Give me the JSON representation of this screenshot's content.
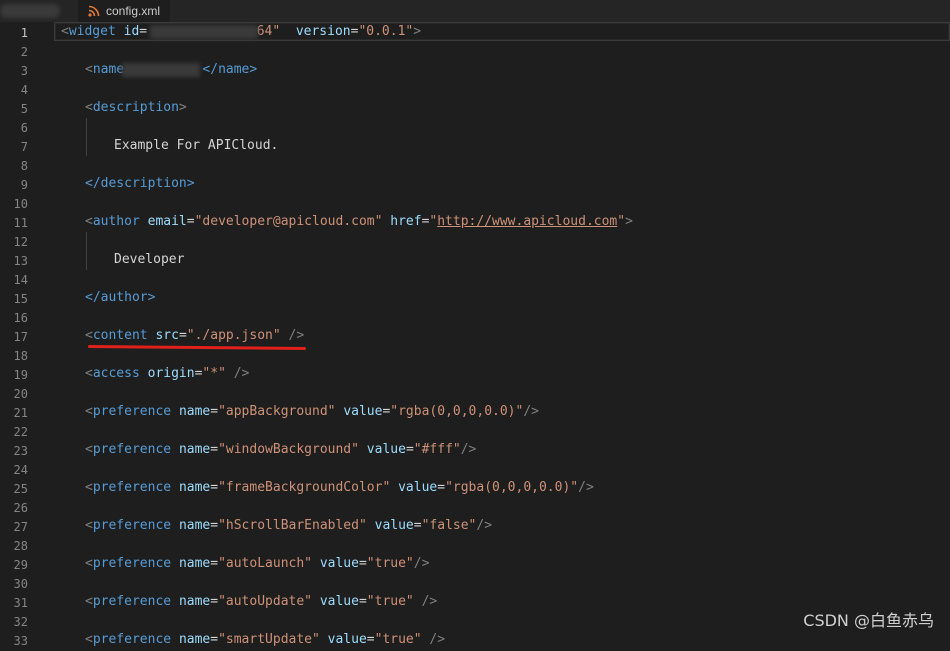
{
  "tab": {
    "label": "config.xml",
    "icon": "rss-icon"
  },
  "line_numbers": [
    "1",
    "2",
    "3",
    "4",
    "5",
    "6",
    "7",
    "8",
    "9",
    "10",
    "11",
    "12",
    "13",
    "14",
    "15",
    "16",
    "17",
    "18",
    "19",
    "20",
    "21",
    "22",
    "23",
    "24",
    "25",
    "26",
    "27",
    "28",
    "29",
    "30",
    "31",
    "32",
    "33"
  ],
  "code": {
    "l1": {
      "open": "<",
      "tag": "widget",
      "attr1": "id",
      "eq1": "=",
      "val1_tail": "64\"",
      "attr2": "version",
      "eq2": "=",
      "val2": "\"0.0.1\"",
      "close": ">"
    },
    "l3": {
      "open": "<",
      "tag": "name",
      "close_tag": "</name>"
    },
    "l5": {
      "open": "<",
      "tag": "description",
      "close": ">"
    },
    "l7": {
      "text": "Example For APICloud."
    },
    "l9": {
      "close_tag": "</description>"
    },
    "l11": {
      "open": "<",
      "tag": "author",
      "attr1": "email",
      "eq1": "=",
      "q1": "\"",
      "val1": "developer@apicloud.com",
      "q1e": "\"",
      "attr2": "href",
      "eq2": "=",
      "q2": "\"",
      "url": "http://www.apicloud.com",
      "q2e": "\"",
      "close": ">"
    },
    "l13": {
      "text": "Developer"
    },
    "l15": {
      "close_tag": "</author>"
    },
    "l17": {
      "open": "<",
      "tag": "content",
      "attr": "src",
      "eq": "=",
      "val": "\"./app.json\"",
      "close": "/>"
    },
    "l19": {
      "open": "<",
      "tag": "access",
      "attr": "origin",
      "eq": "=",
      "val": "\"*\"",
      "close": "/>"
    },
    "l21": {
      "open": "<",
      "tag": "preference",
      "a1": "name",
      "eq1": "=",
      "v1": "\"appBackground\"",
      "a2": "value",
      "eq2": "=",
      "v2": "\"rgba(0,0,0,0.0)\"",
      "close": "/>"
    },
    "l23": {
      "open": "<",
      "tag": "preference",
      "a1": "name",
      "eq1": "=",
      "v1": "\"windowBackground\"",
      "a2": "value",
      "eq2": "=",
      "v2": "\"#fff\"",
      "close": "/>"
    },
    "l25": {
      "open": "<",
      "tag": "preference",
      "a1": "name",
      "eq1": "=",
      "v1": "\"frameBackgroundColor\"",
      "a2": "value",
      "eq2": "=",
      "v2": "\"rgba(0,0,0,0.0)\"",
      "close": "/>"
    },
    "l27": {
      "open": "<",
      "tag": "preference",
      "a1": "name",
      "eq1": "=",
      "v1": "\"hScrollBarEnabled\"",
      "a2": "value",
      "eq2": "=",
      "v2": "\"false\"",
      "close": "/>"
    },
    "l29": {
      "open": "<",
      "tag": "preference",
      "a1": "name",
      "eq1": "=",
      "v1": "\"autoLaunch\"",
      "a2": "value",
      "eq2": "=",
      "v2": "\"true\"",
      "close": "/>"
    },
    "l31": {
      "open": "<",
      "tag": "preference",
      "a1": "name",
      "eq1": "=",
      "v1": "\"autoUpdate\"",
      "a2": "value",
      "eq2": "=",
      "v2": "\"true\"",
      "close": "/>"
    },
    "l33": {
      "open": "<",
      "tag": "preference",
      "a1": "name",
      "eq1": "=",
      "v1": "\"smartUpdate\"",
      "a2": "value",
      "eq2": "=",
      "v2": "\"true\"",
      "close": "/>"
    }
  },
  "watermark": "CSDN @白鱼赤乌",
  "colors": {
    "tag": "#569cd6",
    "attribute": "#9cdcfe",
    "string": "#ce9178",
    "punctuation": "#808080",
    "text": "#d4d4d4",
    "annotation": "#e0201b"
  }
}
